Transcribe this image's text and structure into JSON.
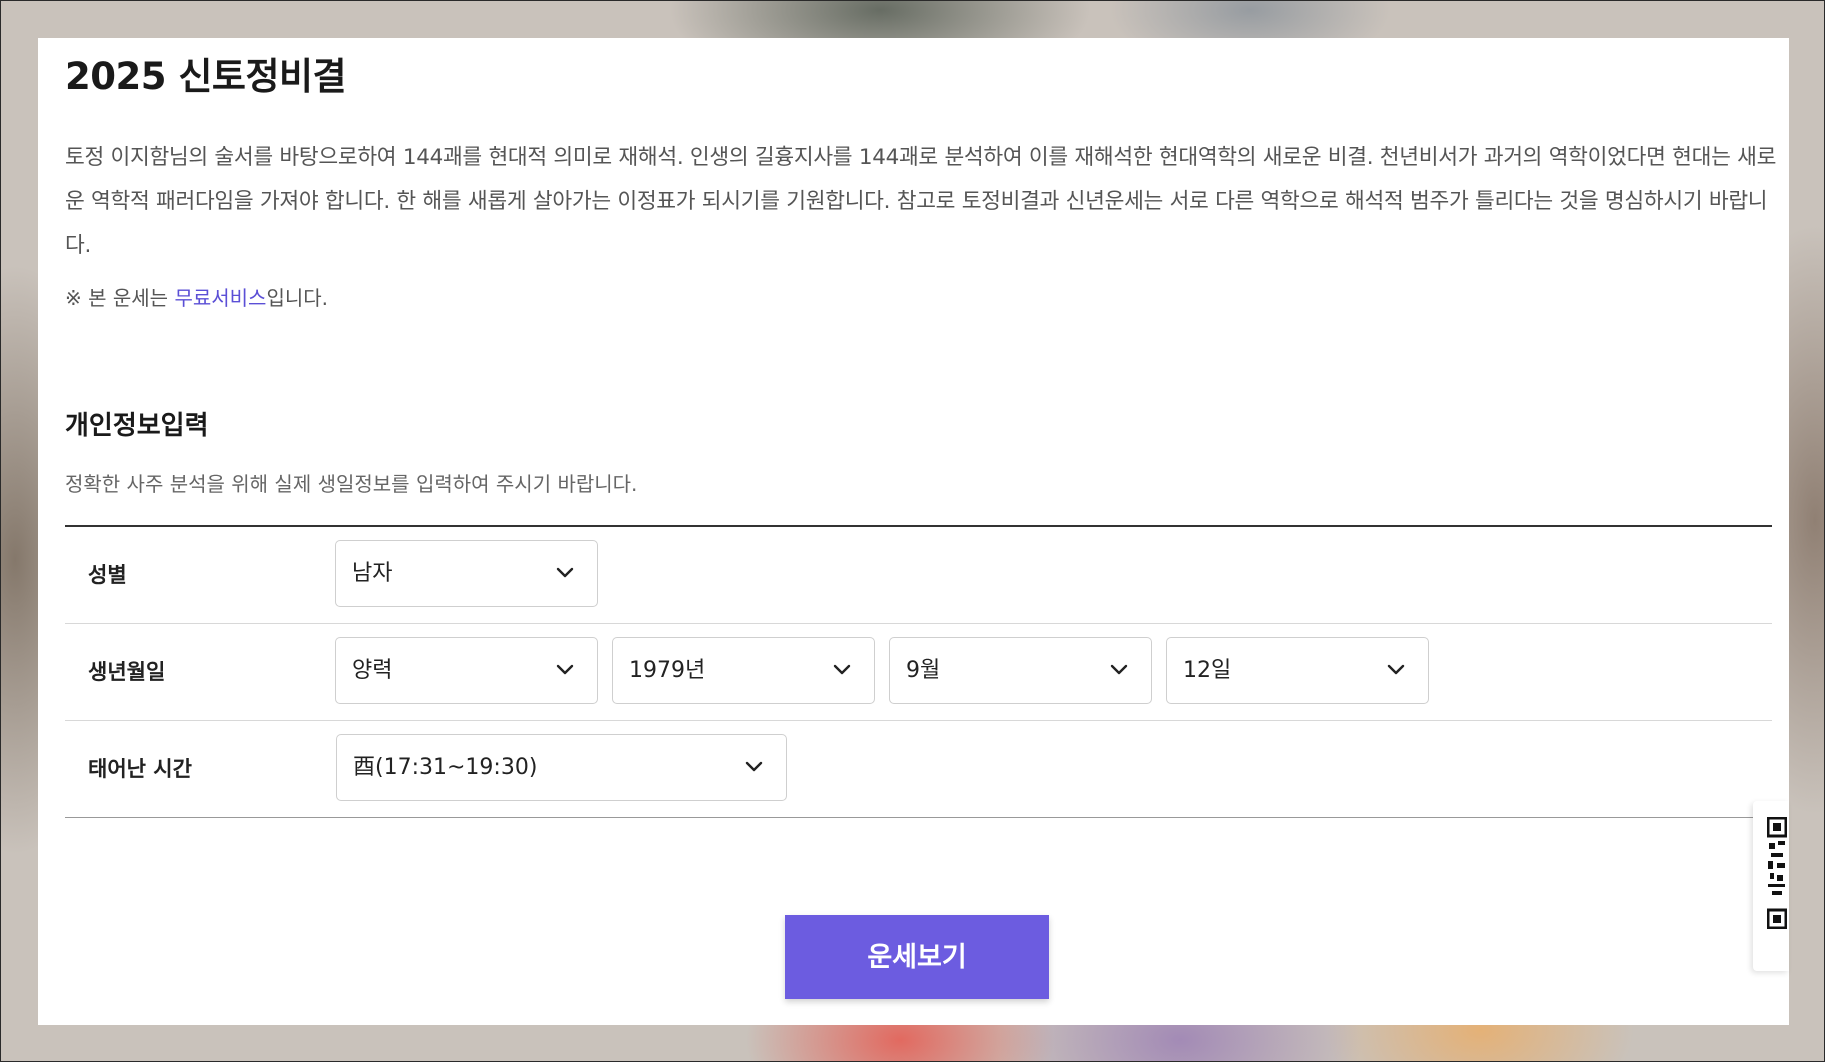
{
  "page": {
    "title": "2025 신토정비결",
    "intro": "토정 이지함님의 술서를 바탕으로하여 144괘를 현대적 의미로 재해석. 인생의 길흉지사를 144괘로 분석하여 이를 재해석한 현대역학의 새로운 비결. 천년비서가 과거의 역학이었다면 현대는 새로운 역학적 패러다임을 가져야 합니다. 한 해를 새롭게 살아가는 이정표가 되시기를 기원합니다. 참고로 토정비결과 신년운세는 서로 다른 역학으로 해석적 범주가 틀리다는 것을 명심하시기 바랍니다.",
    "notice_prefix": "※ 본 운세는 ",
    "notice_highlight": "무료서비스",
    "notice_suffix": "입니다."
  },
  "form": {
    "title": "개인정보입력",
    "description": "정확한 사주 분석을 위해 실제 생일정보를 입력하여 주시기 바랍니다.",
    "gender": {
      "label": "성별",
      "value": "남자"
    },
    "birth": {
      "label": "생년월일",
      "calendar": "양력",
      "year": "1979년",
      "month": "9월",
      "day": "12일"
    },
    "birth_time": {
      "label": "태어난 시간",
      "value": "酉(17:31~19:30)"
    },
    "submit_label": "운세보기"
  },
  "colors": {
    "accent": "#6c5ce0",
    "link": "#5b4fd6"
  },
  "icons": {
    "dropdown": "chevron-down-icon",
    "qr": "qr-code-icon"
  }
}
